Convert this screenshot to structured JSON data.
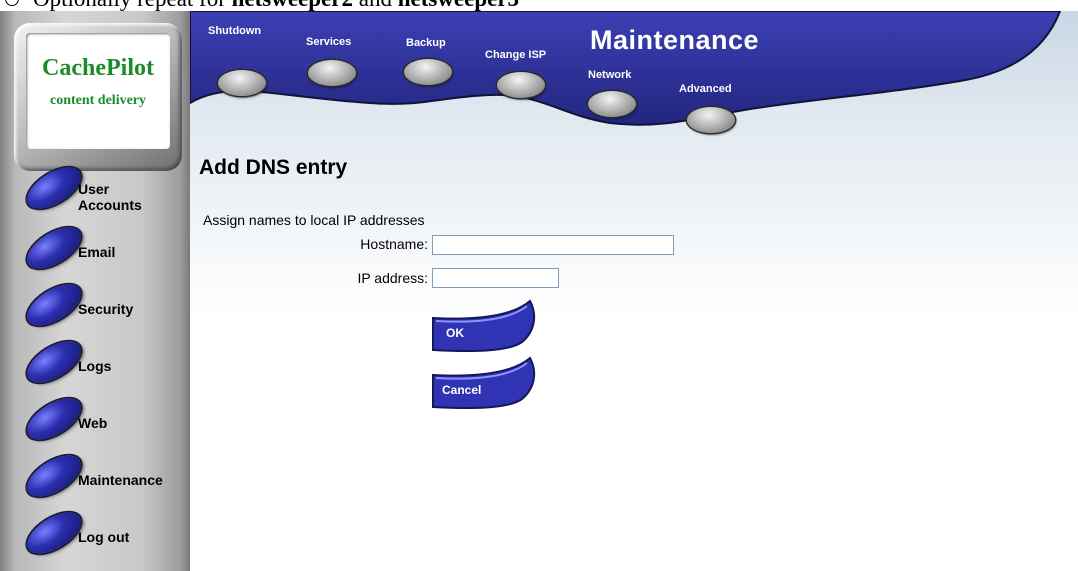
{
  "doc": {
    "prefix": "Optionally repeat for ",
    "name1": "netsweeper2",
    "mid": " and ",
    "name2": "netsweeper3"
  },
  "logo": {
    "title": "CachePilot",
    "subtitle": "content delivery"
  },
  "top_nav": {
    "section": "Maintenance",
    "buttons": [
      "Shutdown",
      "Services",
      "Backup",
      "Change ISP",
      "Network",
      "Advanced"
    ]
  },
  "sidebar": {
    "items": [
      {
        "label_1": "User",
        "label_2": "Accounts"
      },
      {
        "label_1": "Email",
        "label_2": ""
      },
      {
        "label_1": "Security",
        "label_2": ""
      },
      {
        "label_1": "Logs",
        "label_2": ""
      },
      {
        "label_1": "Web",
        "label_2": ""
      },
      {
        "label_1": "Maintenance",
        "label_2": ""
      },
      {
        "label_1": "Log out",
        "label_2": ""
      }
    ]
  },
  "form": {
    "title": "Add DNS entry",
    "intro": "Assign names to local IP addresses",
    "hostname_label": "Hostname:",
    "hostname_value": "",
    "ip_label": "IP address:",
    "ip_value": "",
    "ok_label": "OK",
    "cancel_label": "Cancel"
  },
  "colors": {
    "banner": "#2b2f99",
    "button_blue": "#2f33b4",
    "logo_green": "#1d8b2a"
  }
}
